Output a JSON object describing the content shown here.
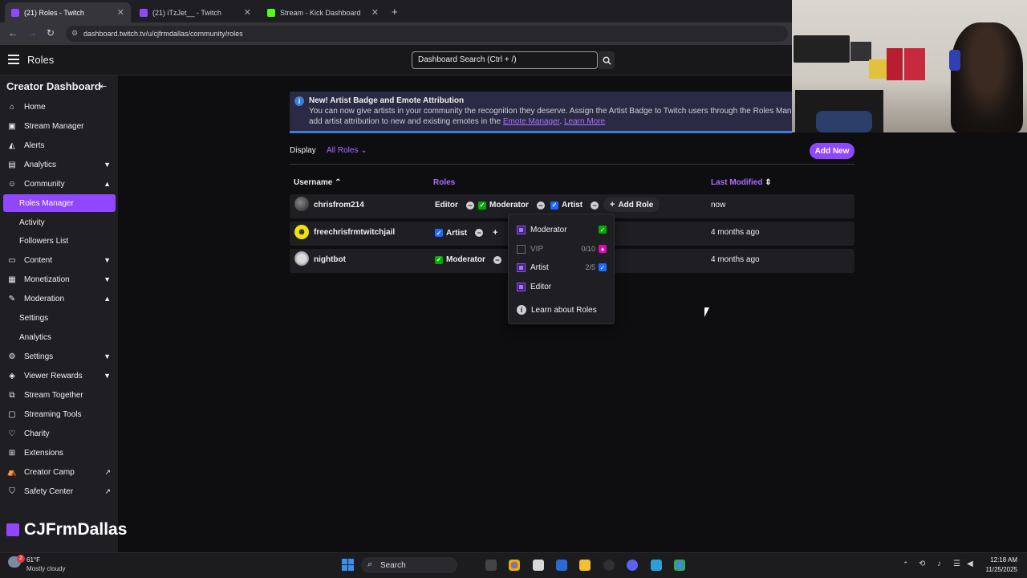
{
  "browser": {
    "tabs": [
      {
        "label": "(21) Roles - Twitch",
        "color": "#9147ff"
      },
      {
        "label": "(21) iTzJet__ - Twitch",
        "color": "#9147ff"
      },
      {
        "label": "Stream - Kick Dashboard",
        "color": "#53fc18"
      }
    ],
    "url": "dashboard.twitch.tv/u/cjfrmdallas/community/roles"
  },
  "topnav": {
    "page_title": "Roles",
    "search_placeholder": "Dashboard Search (Ctrl + /)"
  },
  "sidebar": {
    "title": "Creator Dashboard",
    "items": [
      {
        "label": "Home",
        "icon": "home-icon"
      },
      {
        "label": "Stream Manager",
        "icon": "stream-manager-icon"
      },
      {
        "label": "Alerts",
        "icon": "alerts-icon"
      },
      {
        "label": "Analytics",
        "icon": "analytics-icon",
        "chevron": "down"
      },
      {
        "label": "Community",
        "icon": "community-icon",
        "chevron": "up"
      },
      {
        "label": "Roles Manager",
        "sub": true,
        "active": true
      },
      {
        "label": "Activity",
        "sub": true
      },
      {
        "label": "Followers List",
        "sub": true
      },
      {
        "label": "Content",
        "icon": "content-icon",
        "chevron": "down"
      },
      {
        "label": "Monetization",
        "icon": "monetization-icon",
        "chevron": "down"
      },
      {
        "label": "Moderation",
        "icon": "moderation-icon",
        "chevron": "up"
      },
      {
        "label": "Settings",
        "sub": true
      },
      {
        "label": "Analytics",
        "sub": true
      },
      {
        "label": "Settings",
        "icon": "settings-icon",
        "chevron": "down"
      },
      {
        "label": "Viewer Rewards",
        "icon": "viewer-rewards-icon",
        "chevron": "down"
      },
      {
        "label": "Stream Together",
        "icon": "stream-together-icon"
      },
      {
        "label": "Streaming Tools",
        "icon": "streaming-tools-icon"
      },
      {
        "label": "Charity",
        "icon": "charity-icon"
      },
      {
        "label": "Extensions",
        "icon": "extensions-icon"
      },
      {
        "label": "Creator Camp",
        "icon": "creator-camp-icon",
        "external": true
      },
      {
        "label": "Safety Center",
        "icon": "safety-center-icon",
        "external": true
      }
    ]
  },
  "brand": "CJFrmDallas",
  "banner": {
    "title": "New! Artist Badge and Emote Attribution",
    "line1": "You can now give artists in your community the recognition they deserve. Assign the Artist Badge to Twitch users through the Roles Man",
    "line2_prefix": "add artist attribution to new and existing emotes in the",
    "link1": "Emote Manager",
    "link2": "Learn More"
  },
  "toolbar": {
    "display_label": "Display",
    "filter_label": "All Roles",
    "add_new_label": "Add New"
  },
  "table": {
    "headers": {
      "username": "Username",
      "roles": "Roles",
      "last_modified": "Last Modified"
    },
    "rows": [
      {
        "username": "chrisfrom214",
        "roles": [
          "Editor",
          "Moderator",
          "Artist"
        ],
        "add_role": "Add Role",
        "last_modified": "now"
      },
      {
        "username": "freechrisfrmtwitchjail",
        "roles": [
          "Artist"
        ],
        "last_modified": "4 months ago"
      },
      {
        "username": "nightbot",
        "roles": [
          "Moderator"
        ],
        "last_modified": "4 months ago"
      }
    ]
  },
  "dropdown": {
    "items": [
      {
        "label": "Moderator",
        "count": "",
        "checked": true
      },
      {
        "label": "VIP",
        "count": "0/10",
        "checked": false
      },
      {
        "label": "Artist",
        "count": "2/5",
        "checked": true
      },
      {
        "label": "Editor",
        "count": "",
        "checked": true
      }
    ],
    "learn": "Learn about Roles"
  },
  "taskbar": {
    "weather_temp": "61°F",
    "weather_desc": "Mostly cloudy",
    "weather_badge": "2",
    "search": "Search",
    "time": "12:18 AM",
    "date": "11/25/2025"
  }
}
